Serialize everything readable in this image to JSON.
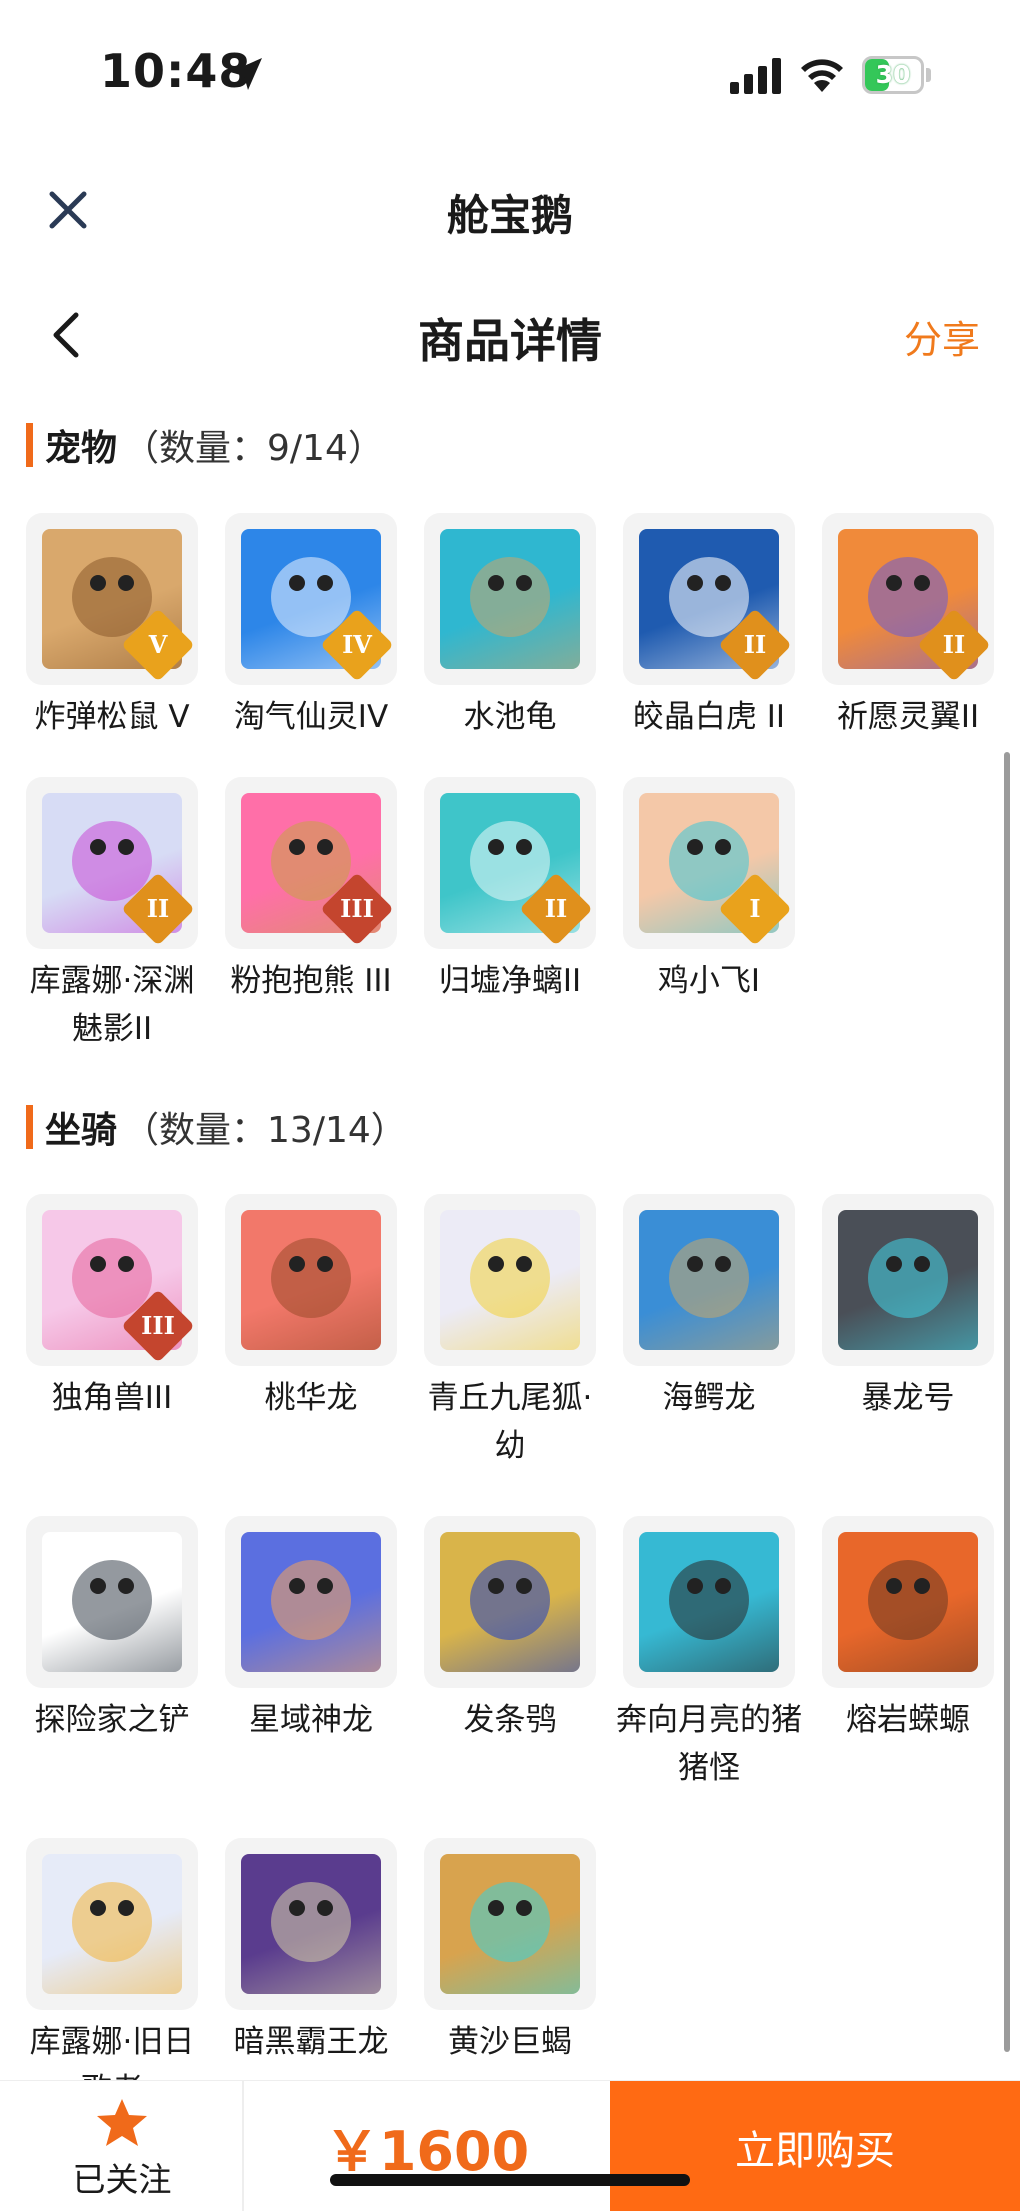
{
  "status": {
    "time": "10:48",
    "battery": "30"
  },
  "app": {
    "title": "舱宝鹅"
  },
  "page": {
    "title": "商品详情",
    "share_label": "分享"
  },
  "pets": {
    "name": "宠物",
    "count": "（数量：9/14）",
    "items": [
      {
        "label": "炸弹松鼠 V",
        "tier": "V",
        "icon": "squirrel-pet",
        "bg": "#d9a86c",
        "accent": "#8b5a2b"
      },
      {
        "label": "淘气仙灵IV",
        "tier": "IV",
        "icon": "blue-dog-pet",
        "bg": "#2d86e8",
        "accent": "#eaf3ff"
      },
      {
        "label": "水池龟",
        "tier": "",
        "icon": "turtle-pet",
        "bg": "#2fb7d0",
        "accent": "#caa56a"
      },
      {
        "label": "皎晶白虎 II",
        "tier": "II",
        "icon": "white-tiger-pet",
        "bg": "#1f5bb0",
        "accent": "#ffffff"
      },
      {
        "label": "祈愿灵翼II",
        "tier": "II",
        "icon": "bird-pet",
        "bg": "#f08a3a",
        "accent": "#6a5bd6"
      },
      {
        "label": "库露娜·深渊魅影II",
        "tier": "II",
        "icon": "spirit-girl-pet",
        "bg": "#d7dcf5",
        "accent": "#c94bd6"
      },
      {
        "label": "粉抱抱熊 III",
        "tier": "III",
        "icon": "pink-bear-pet",
        "bg": "#ff6fa8",
        "accent": "#c9a245"
      },
      {
        "label": "归墟净螭II",
        "tier": "II",
        "icon": "sea-dragon-pet",
        "bg": "#3fc5c9",
        "accent": "#e8f8f8"
      },
      {
        "label": "鸡小飞I",
        "tier": "I",
        "icon": "chick-pet",
        "bg": "#f4c8a8",
        "accent": "#3cc8d8"
      }
    ]
  },
  "mounts": {
    "name": "坐骑",
    "count": "（数量：13/14）",
    "items": [
      {
        "label": "独角兽III",
        "tier": "III",
        "icon": "unicorn-mount",
        "bg": "#f6c8e8",
        "accent": "#e5659b"
      },
      {
        "label": "桃华龙",
        "tier": "",
        "icon": "peach-dragon-mount",
        "bg": "#f2786a",
        "accent": "#9b4a2a"
      },
      {
        "label": "青丘九尾狐·幼",
        "tier": "",
        "icon": "nine-tail-fox-mount",
        "bg": "#ecebf6",
        "accent": "#f3d23a"
      },
      {
        "label": "海鳄龙",
        "tier": "",
        "icon": "sea-croc-dragon-mount",
        "bg": "#3a8ed6",
        "accent": "#c8a76a"
      },
      {
        "label": "暴龙号",
        "tier": "",
        "icon": "mecha-rex-mount",
        "bg": "#4a4f57",
        "accent": "#42d4e6"
      },
      {
        "label": "探险家之铲",
        "tier": "",
        "icon": "shovel-mount",
        "bg": "#ffffff",
        "accent": "#3d4650"
      },
      {
        "label": "星域神龙",
        "tier": "",
        "icon": "star-dragon-mount",
        "bg": "#5b6fe0",
        "accent": "#f4a25a"
      },
      {
        "label": "发条鸮",
        "tier": "",
        "icon": "clockwork-owl-mount",
        "bg": "#d9b44a",
        "accent": "#1f3fc4"
      },
      {
        "label": "奔向月亮的猪猪怪",
        "tier": "",
        "icon": "moon-pig-mount",
        "bg": "#36b9d3",
        "accent": "#2a2a2a"
      },
      {
        "label": "熔岩蝾螈",
        "tier": "",
        "icon": "lava-axolotl-mount",
        "bg": "#e8672a",
        "accent": "#6b3a22"
      },
      {
        "label": "库露娜·旧日歌者",
        "tier": "",
        "icon": "singer-girl-mount",
        "bg": "#e6ebf8",
        "accent": "#f2b43a"
      },
      {
        "label": "暗黑霸王龙",
        "tier": "",
        "icon": "dark-rex-mount",
        "bg": "#5a3c8e",
        "accent": "#d7d0a8"
      },
      {
        "label": "黄沙巨蝎",
        "tier": "",
        "icon": "sand-scorpion-mount",
        "bg": "#d8a34e",
        "accent": "#3ad1d8"
      }
    ]
  },
  "bottom": {
    "follow_label": "已关注",
    "price": "￥1600",
    "buy_label": "立即购买"
  },
  "colors": {
    "accent": "#f06a1a",
    "buy": "#ff6a13",
    "share": "#f07a1c"
  }
}
